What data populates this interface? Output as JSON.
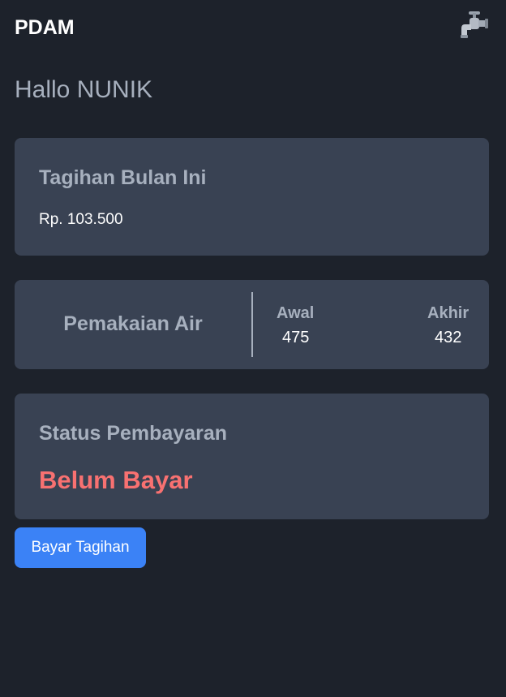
{
  "header": {
    "brand": "PDAM",
    "icon": "water-tap-icon"
  },
  "greeting": "Hallo NUNIK",
  "bill": {
    "title": "Tagihan Bulan Ini",
    "amount": "Rp. 103.500"
  },
  "usage": {
    "label": "Pemakaian Air",
    "start_label": "Awal",
    "start_value": "475",
    "end_label": "Akhir",
    "end_value": "432"
  },
  "payment_status": {
    "title": "Status Pembayaran",
    "value": "Belum Bayar",
    "value_color": "#f87171"
  },
  "actions": {
    "pay_button": "Bayar Tagihan"
  },
  "colors": {
    "background": "#1d222b",
    "card": "#394253",
    "muted_text": "#a7b0be",
    "accent": "#3b82f6"
  }
}
